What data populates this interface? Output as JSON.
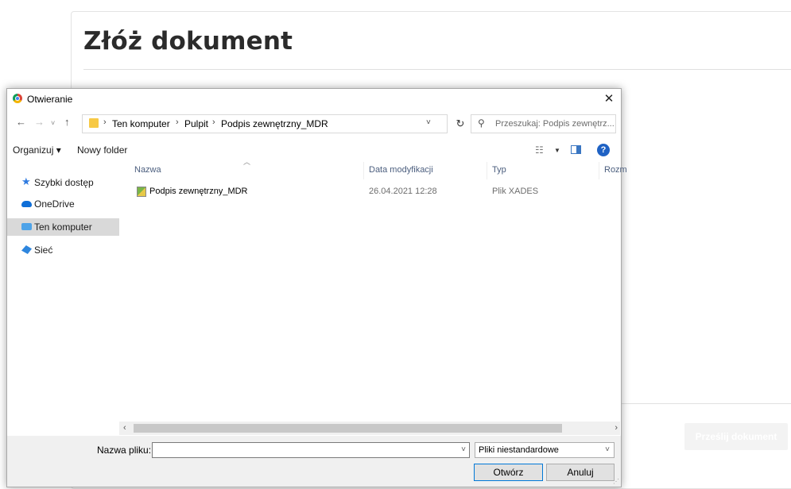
{
  "page": {
    "title": "Złóż dokument",
    "submit_button": "Prześlij dokument"
  },
  "dialog": {
    "title": "Otwieranie",
    "close_symbol": "✕",
    "address": {
      "path": [
        "Ten komputer",
        "Pulpit",
        "Podpis zewnętrzny_MDR"
      ],
      "separator": "›"
    },
    "search": {
      "placeholder": "Przeszukaj: Podpis zewnętrz..."
    },
    "toolbar": {
      "organize": "Organizuj ▾",
      "new_folder": "Nowy folder"
    },
    "nav": {
      "items": [
        {
          "label": "Szybki dostęp",
          "icon": "star-icon"
        },
        {
          "label": "OneDrive",
          "icon": "cloud-icon"
        },
        {
          "label": "Ten komputer",
          "icon": "computer-icon",
          "selected": true
        },
        {
          "label": "Sieć",
          "icon": "network-icon"
        }
      ]
    },
    "columns": {
      "name": "Nazwa",
      "modified": "Data modyfikacji",
      "type": "Typ",
      "size": "Rozm"
    },
    "files": [
      {
        "name": "Podpis zewnętrzny_MDR",
        "modified": "26.04.2021 12:28",
        "type": "Plik XADES"
      }
    ],
    "filename_label": "Nazwa pliku:",
    "filename_value": "",
    "filetype": "Pliki niestandardowe",
    "open_button": "Otwórz",
    "cancel_button": "Anuluj"
  },
  "colors": {
    "accent": "#0078d7",
    "selected_nav": "#d9d9d9",
    "help_icon": "#1f62c4"
  }
}
